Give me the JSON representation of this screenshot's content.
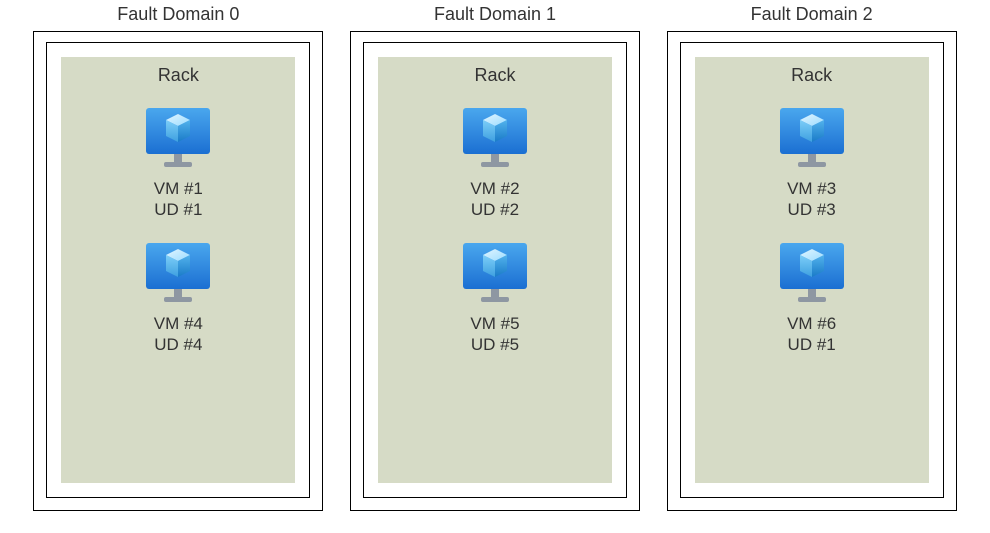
{
  "fault_domains": [
    {
      "title": "Fault Domain 0",
      "rack_label": "Rack",
      "vms": [
        {
          "vm_label": "VM #1",
          "ud_label": "UD #1"
        },
        {
          "vm_label": "VM #4",
          "ud_label": "UD #4"
        }
      ]
    },
    {
      "title": "Fault Domain 1",
      "rack_label": "Rack",
      "vms": [
        {
          "vm_label": "VM #2",
          "ud_label": "UD #2"
        },
        {
          "vm_label": "VM #5",
          "ud_label": "UD #5"
        }
      ]
    },
    {
      "title": "Fault Domain 2",
      "rack_label": "Rack",
      "vms": [
        {
          "vm_label": "VM #3",
          "ud_label": "UD #3"
        },
        {
          "vm_label": "VM #6",
          "ud_label": "UD #1"
        }
      ]
    }
  ]
}
